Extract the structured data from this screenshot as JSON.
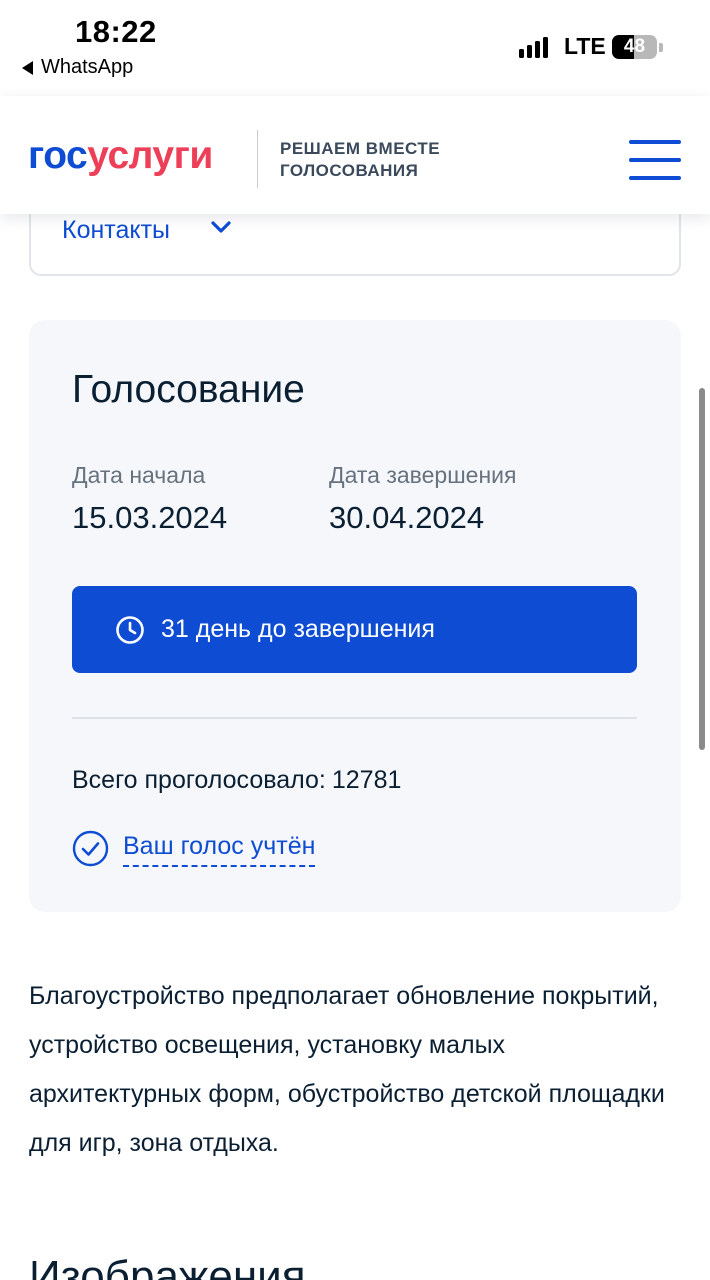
{
  "status_bar": {
    "time": "18:22",
    "back_app": "WhatsApp",
    "network": "LTE",
    "battery": "48",
    "battery_level": 0.48
  },
  "header": {
    "logo_part1": "гос",
    "logo_part2": "услуги",
    "tagline_line1": "РЕШАЕМ ВМЕСТЕ",
    "tagline_line2": "ГОЛОСОВАНИЯ",
    "menu_icon": "hamburger-icon"
  },
  "contacts": {
    "label": "Контакты",
    "icon": "chevron-down-icon"
  },
  "voting": {
    "title": "Голосование",
    "start_label": "Дата начала",
    "start_date": "15.03.2024",
    "end_label": "Дата завершения",
    "end_date": "30.04.2024",
    "countdown": "31 день до завершения",
    "countdown_icon": "clock-icon",
    "total_label": "Всего проголосовало:",
    "total_count": "12781",
    "voted_status": "Ваш голос учтён",
    "voted_icon": "check-circle-icon"
  },
  "description": "Благоустройство предполагает обновление покрытий, устройство освещения, установку малых архитектурных форм, обустройство детской площадки для игр, зона отдыха.",
  "next_section": "Изображения",
  "colors": {
    "brand_blue": "#0d4cd3",
    "brand_red": "#ee3f58",
    "card_bg": "#f5f7fa",
    "text_dark": "#0b1f33",
    "text_muted": "#66727f"
  }
}
